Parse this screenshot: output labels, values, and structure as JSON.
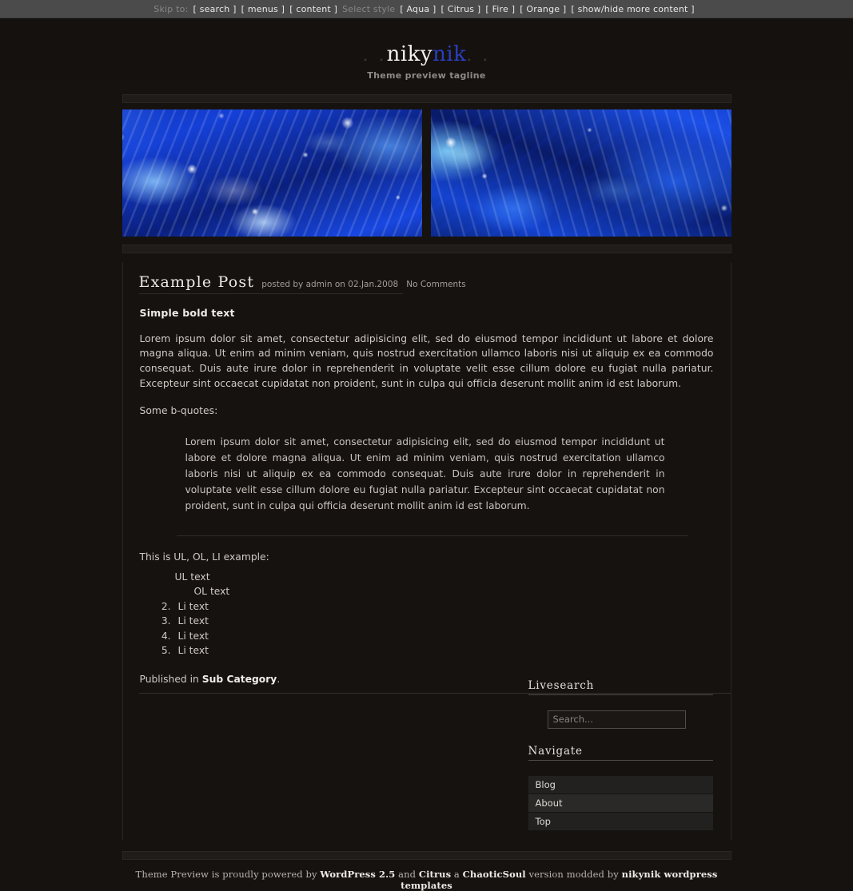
{
  "skipbar": {
    "skip_label": "Skip to:",
    "skip_links": [
      "[ search ]",
      "[ menus ]",
      "[ content ]"
    ],
    "style_label": "Select style",
    "style_links": [
      "[ Aqua ]",
      "[ Citrus ]",
      "[ Fire ]",
      "[ Orange ]",
      "[ show/hide more content ]"
    ]
  },
  "header": {
    "dots_left": ". .",
    "title_part1": "niky",
    "title_part2": "nik",
    "dots_right": ". .",
    "tagline": "Theme preview tagline",
    "accent_color": "#2a3fbe"
  },
  "post": {
    "title": "Example Post",
    "meta_prefix": "posted by",
    "meta_author": "admin",
    "meta_on": "on",
    "meta_date": "02.Jan.2008",
    "meta_comments": "No Comments",
    "bold_heading": "Simple bold text",
    "paragraph1": "Lorem ipsum dolor sit amet, consectetur adipisicing elit, sed do eiusmod tempor incididunt ut labore et dolore magna aliqua. Ut enim ad minim veniam, quis nostrud exercitation ullamco laboris nisi ut aliquip ex ea commodo consequat. Duis aute irure dolor in reprehenderit in voluptate velit esse cillum dolore eu fugiat nulla pariatur. Excepteur sint occaecat cupidatat non proident, sunt in culpa qui officia deserunt mollit anim id est laborum.",
    "bquote_intro": "Some b-quotes:",
    "blockquote": "Lorem ipsum dolor sit amet, consectetur adipisicing elit, sed do eiusmod tempor incididunt ut labore et dolore magna aliqua. Ut enim ad minim veniam, quis nostrud exercitation ullamco laboris nisi ut aliquip ex ea commodo consequat. Duis aute irure dolor in reprehenderit in voluptate velit esse cillum dolore eu fugiat nulla pariatur. Excepteur sint occaecat cupidatat non proident, sunt in culpa qui officia deserunt mollit anim id est laborum.",
    "list_intro": "This is UL, OL, LI example:",
    "ul_item": "UL text",
    "ol_head": "OL text",
    "ol_items": [
      "Li text",
      "Li text",
      "Li text",
      "Li text"
    ],
    "published_prefix": "Published in",
    "published_category": "Sub Category",
    "published_suffix": "."
  },
  "sidebar": {
    "livesearch": {
      "title": "Livesearch",
      "search_placeholder": "Search...",
      "search_value": ""
    },
    "navigate": {
      "title": "Navigate",
      "items": [
        "Blog",
        "About",
        "Top"
      ]
    }
  },
  "footer": {
    "text_start": "Theme Preview is proudly powered by",
    "wordpress": "WordPress 2.5",
    "text_and": "and",
    "citrus": "Citrus",
    "text_a": "a",
    "chaoticsoul": "ChaoticSoul",
    "text_version": "version modded by",
    "nikynik": "nikynik wordpress templates"
  }
}
